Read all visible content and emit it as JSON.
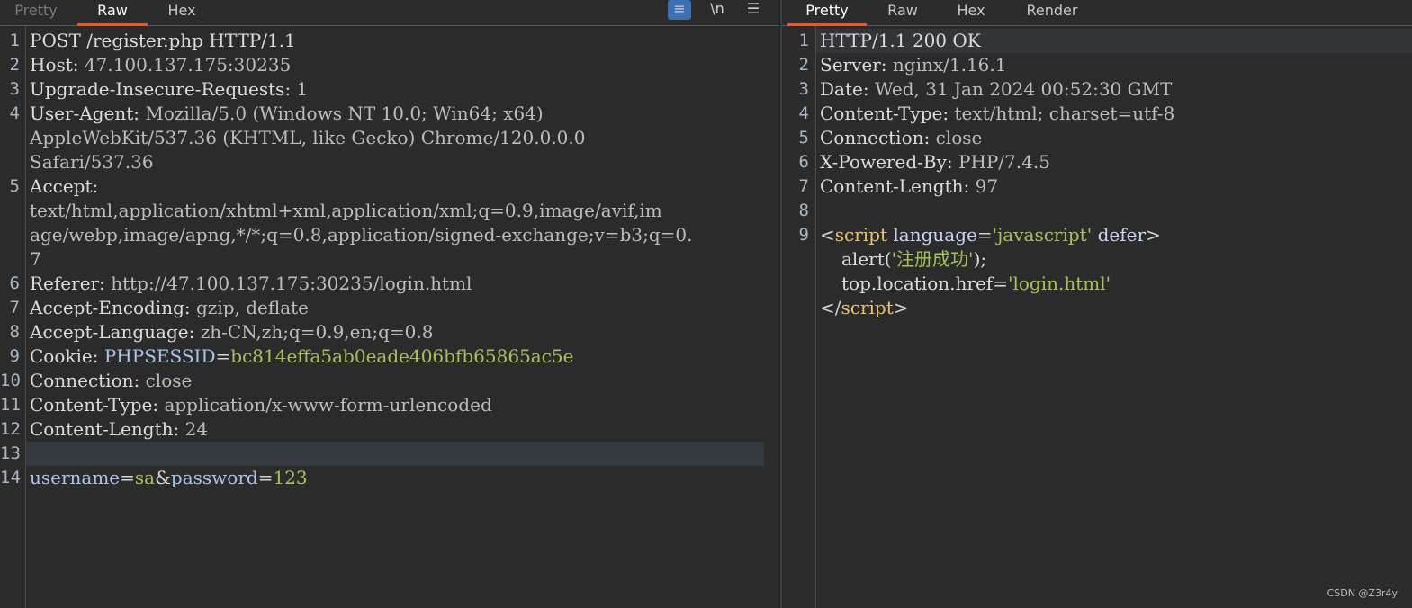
{
  "request_panel": {
    "tabs": [
      "Pretty",
      "Raw",
      "Hex"
    ],
    "active_tab": "Raw",
    "toolbar": {
      "wrap_icon": "≡",
      "newline_label": "\\n",
      "menu_icon": "☰"
    },
    "lines": [
      {
        "n": "1",
        "parts": [
          {
            "t": "POST /register.php HTTP/1.1",
            "c": "k"
          }
        ]
      },
      {
        "n": "2",
        "parts": [
          {
            "t": "Host: ",
            "c": "k"
          },
          {
            "t": "47.100.137.175:30235",
            "c": "v"
          }
        ]
      },
      {
        "n": "3",
        "parts": [
          {
            "t": "Upgrade-Insecure-Requests: ",
            "c": "k"
          },
          {
            "t": "1",
            "c": "v"
          }
        ]
      },
      {
        "n": "4",
        "parts": [
          {
            "t": "User-Agent: ",
            "c": "k"
          },
          {
            "t": "Mozilla/5.0 (Windows NT 10.0; Win64; x64)",
            "c": "v"
          }
        ]
      },
      {
        "n": "",
        "parts": [
          {
            "t": "AppleWebKit/537.36 (KHTML, like Gecko) Chrome/120.0.0.0",
            "c": "v"
          }
        ]
      },
      {
        "n": "",
        "parts": [
          {
            "t": "Safari/537.36",
            "c": "v"
          }
        ]
      },
      {
        "n": "5",
        "parts": [
          {
            "t": "Accept:",
            "c": "k"
          }
        ]
      },
      {
        "n": "",
        "parts": [
          {
            "t": "text/html,application/xhtml+xml,application/xml;q=0.9,image/avif,im",
            "c": "v"
          }
        ]
      },
      {
        "n": "",
        "parts": [
          {
            "t": "age/webp,image/apng,*/*;q=0.8,application/signed-exchange;v=b3;q=0.",
            "c": "v"
          }
        ]
      },
      {
        "n": "",
        "parts": [
          {
            "t": "7",
            "c": "v"
          }
        ]
      },
      {
        "n": "6",
        "parts": [
          {
            "t": "Referer: ",
            "c": "k"
          },
          {
            "t": "http://47.100.137.175:30235/login.html",
            "c": "v"
          }
        ]
      },
      {
        "n": "7",
        "parts": [
          {
            "t": "Accept-Encoding: ",
            "c": "k"
          },
          {
            "t": "gzip, deflate",
            "c": "v"
          }
        ]
      },
      {
        "n": "8",
        "parts": [
          {
            "t": "Accept-Language: ",
            "c": "k"
          },
          {
            "t": "zh-CN,zh;q=0.9,en;q=0.8",
            "c": "v"
          }
        ]
      },
      {
        "n": "9",
        "parts": [
          {
            "t": "Cookie: ",
            "c": "k"
          },
          {
            "t": "PHPSESSID",
            "c": "accent"
          },
          {
            "t": "=",
            "c": "punc"
          },
          {
            "t": "bc814effa5ab0eade406bfb65865ac5e",
            "c": "green"
          }
        ]
      },
      {
        "n": "10",
        "parts": [
          {
            "t": "Connection: ",
            "c": "k"
          },
          {
            "t": "close",
            "c": "v"
          }
        ]
      },
      {
        "n": "11",
        "parts": [
          {
            "t": "Content-Type: ",
            "c": "k"
          },
          {
            "t": "application/x-www-form-urlencoded",
            "c": "v"
          }
        ]
      },
      {
        "n": "12",
        "parts": [
          {
            "t": "Content-Length: ",
            "c": "k"
          },
          {
            "t": "24",
            "c": "v"
          }
        ]
      },
      {
        "n": "13",
        "parts": [],
        "highlight": true
      },
      {
        "n": "14",
        "parts": [
          {
            "t": "username",
            "c": "accent"
          },
          {
            "t": "=",
            "c": "punc"
          },
          {
            "t": "sa",
            "c": "green"
          },
          {
            "t": "&",
            "c": "punc"
          },
          {
            "t": "password",
            "c": "accent"
          },
          {
            "t": "=",
            "c": "punc"
          },
          {
            "t": "123",
            "c": "green"
          }
        ]
      }
    ]
  },
  "response_panel": {
    "tabs": [
      "Pretty",
      "Raw",
      "Hex",
      "Render"
    ],
    "active_tab": "Pretty",
    "lines": [
      {
        "n": "1",
        "parts": [
          {
            "t": "HTTP/1.1 200 OK",
            "c": "k"
          }
        ],
        "highlight": true
      },
      {
        "n": "2",
        "parts": [
          {
            "t": "Server: ",
            "c": "k"
          },
          {
            "t": "nginx/1.16.1",
            "c": "v"
          }
        ]
      },
      {
        "n": "3",
        "parts": [
          {
            "t": "Date: ",
            "c": "k"
          },
          {
            "t": "Wed, 31 Jan 2024 00:52:30 GMT",
            "c": "v"
          }
        ]
      },
      {
        "n": "4",
        "parts": [
          {
            "t": "Content-Type: ",
            "c": "k"
          },
          {
            "t": "text/html; charset=utf-8",
            "c": "v"
          }
        ]
      },
      {
        "n": "5",
        "parts": [
          {
            "t": "Connection: ",
            "c": "k"
          },
          {
            "t": "close",
            "c": "v"
          }
        ]
      },
      {
        "n": "6",
        "parts": [
          {
            "t": "X-Powered-By: ",
            "c": "k"
          },
          {
            "t": "PHP/7.4.5",
            "c": "v"
          }
        ]
      },
      {
        "n": "7",
        "parts": [
          {
            "t": "Content-Length: ",
            "c": "k"
          },
          {
            "t": "97",
            "c": "v"
          }
        ]
      },
      {
        "n": "8",
        "parts": []
      },
      {
        "n": "9",
        "parts": [
          {
            "t": "<",
            "c": "punc"
          },
          {
            "t": "script",
            "c": "tagname"
          },
          {
            "t": " language",
            "c": "attr"
          },
          {
            "t": "=",
            "c": "punc"
          },
          {
            "t": "'javascript'",
            "c": "str"
          },
          {
            "t": " defer",
            "c": "attr"
          },
          {
            "t": ">",
            "c": "punc"
          }
        ]
      },
      {
        "n": "",
        "indent": true,
        "parts": [
          {
            "t": "alert(",
            "c": "k"
          },
          {
            "t": "'注册成功'",
            "c": "str"
          },
          {
            "t": ");",
            "c": "k"
          }
        ]
      },
      {
        "n": "",
        "indent": true,
        "parts": [
          {
            "t": "top.location.href=",
            "c": "k"
          },
          {
            "t": "'login.html'",
            "c": "str"
          }
        ]
      },
      {
        "n": "",
        "parts": [
          {
            "t": "</",
            "c": "punc"
          },
          {
            "t": "script",
            "c": "tagname"
          },
          {
            "t": ">",
            "c": "punc"
          }
        ]
      }
    ]
  },
  "watermark": "CSDN @Z3r4y"
}
